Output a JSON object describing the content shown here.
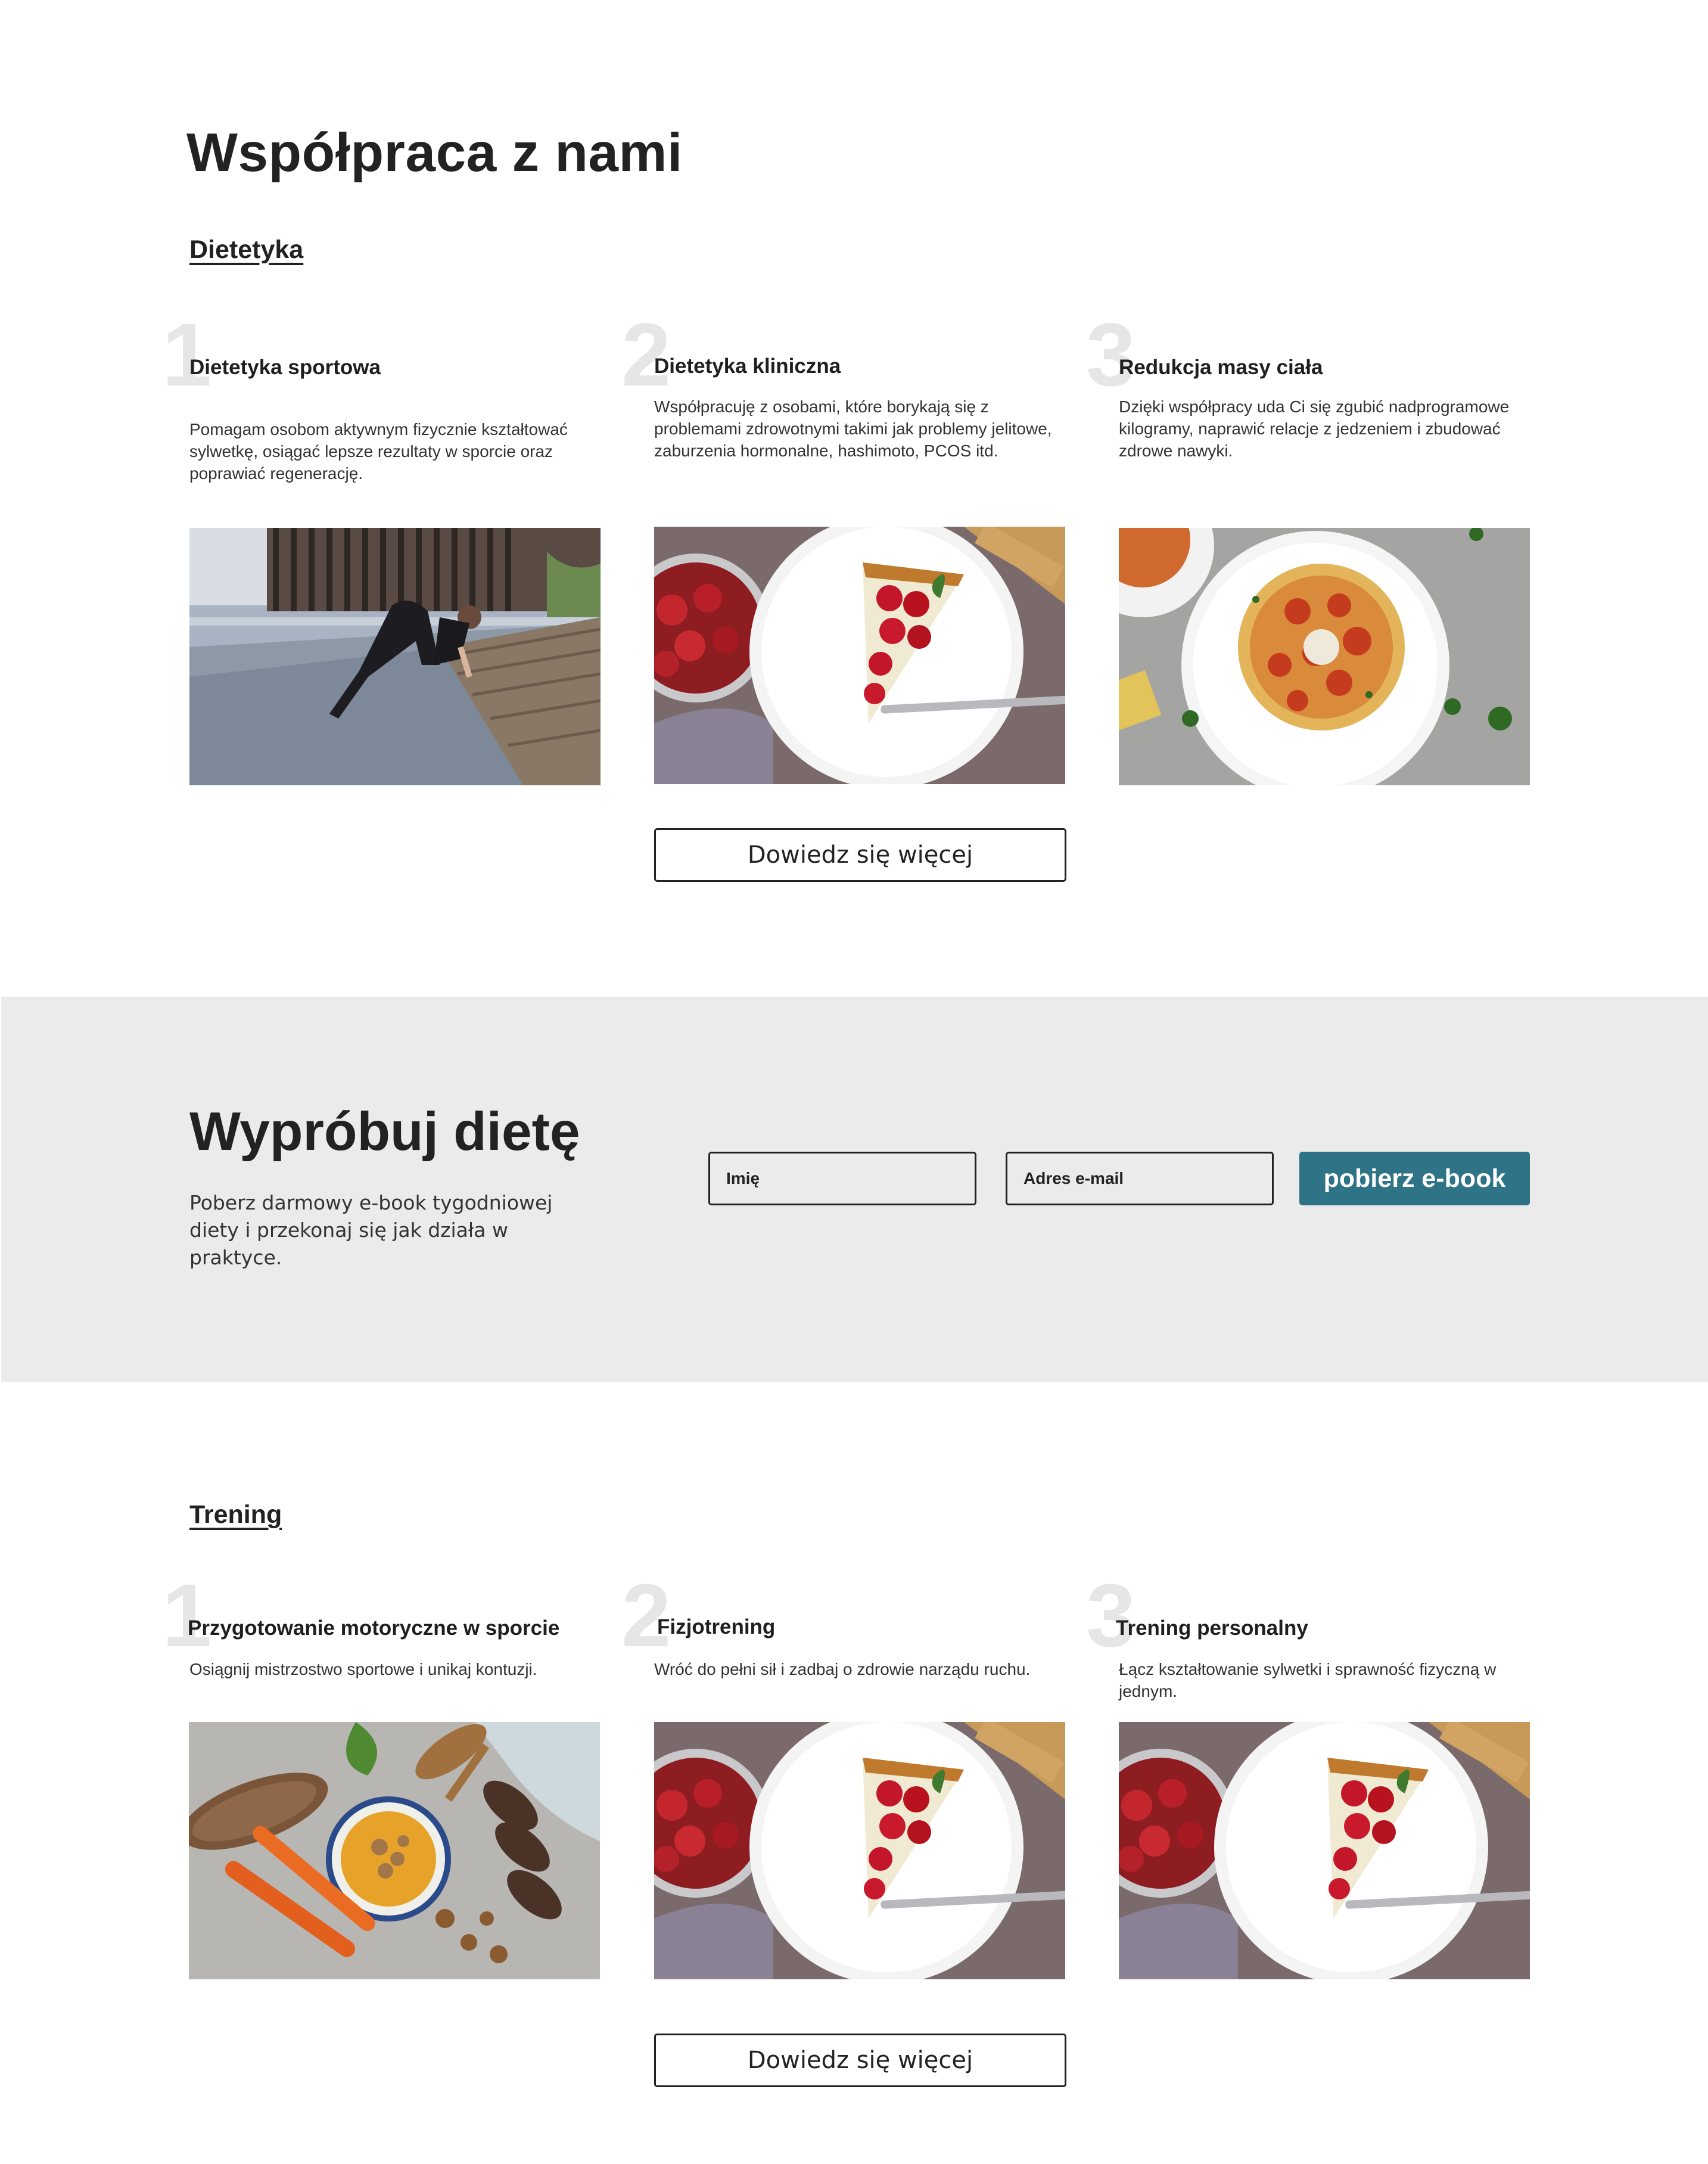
{
  "page": {
    "title": "Współpraca z nami"
  },
  "dietetyka": {
    "heading": "Dietetyka",
    "cards": [
      {
        "num": "1",
        "title": "Dietetyka sportowa",
        "desc": "Pomagam osobom aktywnym fizycznie kształtować sylwetkę, osiągać lepsze rezultaty w sporcie oraz poprawiać regenerację.",
        "image": "woman-stretching-photo"
      },
      {
        "num": "2",
        "title": "Dietetyka kliniczna",
        "desc": "Współpracuję z osobami, które borykają się z problemami zdrowotnymi takimi jak problemy jelitowe, zaburzenia hormonalne, hashimoto, PCOS itd.",
        "image": "raspberry-tart-photo"
      },
      {
        "num": "3",
        "title": "Redukcja masy ciała",
        "desc": "Dzięki współpracy uda Ci się zgubić nadprogramowe kilogramy, naprawić relacje z jedzeniem i zbudować zdrowe nawyki.",
        "image": "spaghetti-photo"
      }
    ],
    "button": "Dowiedz się więcej"
  },
  "ebook": {
    "title": "Wypróbuj dietę",
    "desc": "Poberz darmowy e-book tygodniowej diety i przekonaj się jak działa w praktyce.",
    "name_placeholder": "Imię",
    "email_placeholder": "Adres e-mail",
    "button": "pobierz e-book",
    "accent": "#2f7386"
  },
  "trening": {
    "heading": "Trening",
    "cards": [
      {
        "num": "1",
        "title": "Przygotowanie motoryczne w sporcie",
        "desc": "Osiągnij mistrzostwo sportowe i unikaj kontuzji.",
        "image": "pumpkin-soup-photo"
      },
      {
        "num": "2",
        "title": "Fizjotrening",
        "desc": "Wróć do pełni sił i zadbaj o zdrowie narządu ruchu.",
        "image": "raspberry-tart-photo"
      },
      {
        "num": "3",
        "title": "Trening personalny",
        "desc": "Łącz kształtowanie sylwetki i sprawność fizyczną w jednym.",
        "image": "raspberry-tart-photo"
      }
    ],
    "button": "Dowiedz się więcej"
  }
}
